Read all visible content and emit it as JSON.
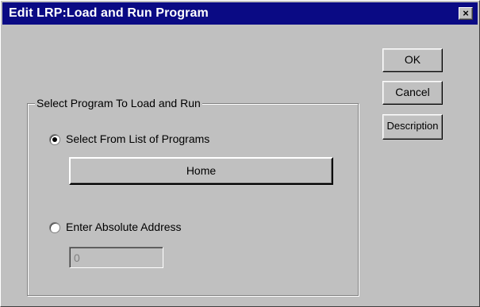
{
  "window": {
    "title": "Edit LRP:Load and Run Program",
    "close_label": "×"
  },
  "buttons": {
    "ok": "OK",
    "cancel": "Cancel",
    "description": "Description"
  },
  "group": {
    "legend": "Select Program To Load and Run",
    "option_list": {
      "label": "Select From List of Programs",
      "selected": true,
      "program_button_label": "Home"
    },
    "option_address": {
      "label": "Enter Absolute Address",
      "selected": false,
      "value": "0"
    }
  }
}
